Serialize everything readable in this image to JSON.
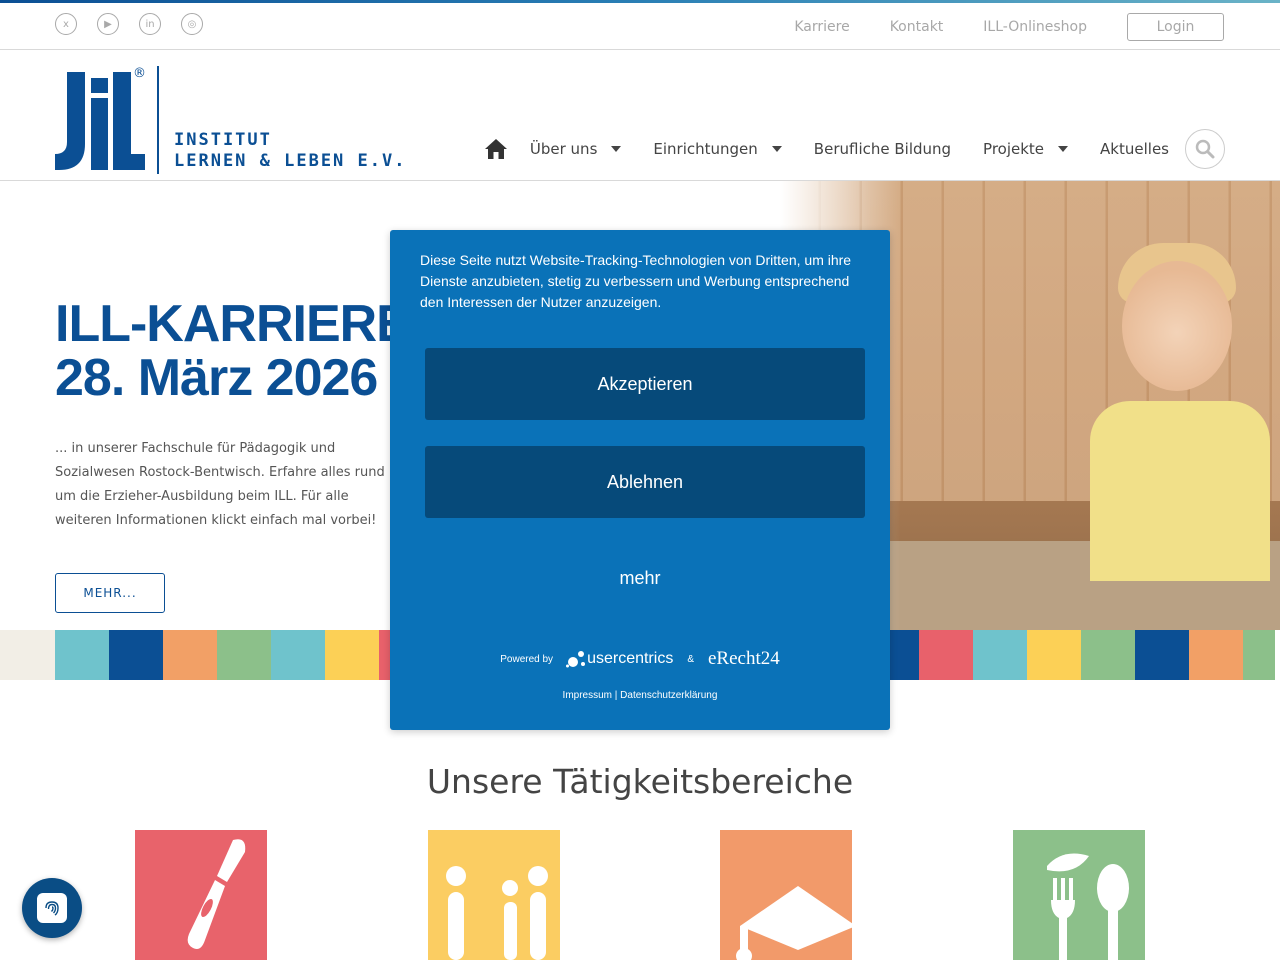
{
  "topbar": {
    "social_icons": [
      "xing-icon",
      "youtube-icon",
      "linkedin-icon",
      "instagram-icon"
    ],
    "links": [
      "Karriere",
      "Kontakt",
      "ILL-Onlineshop"
    ],
    "login_label": "Login"
  },
  "logo": {
    "mark": "JiL",
    "registered": "®",
    "line1": "INSTITUT",
    "line2": "LERNEN & LEBEN E.V."
  },
  "nav": {
    "items": [
      {
        "label": "Über uns",
        "has_dropdown": true
      },
      {
        "label": "Einrichtungen",
        "has_dropdown": true
      },
      {
        "label": "Berufliche Bildung",
        "has_dropdown": false
      },
      {
        "label": "Projekte",
        "has_dropdown": true
      },
      {
        "label": "Aktuelles",
        "has_dropdown": false
      }
    ]
  },
  "hero": {
    "title_line1": "ILL-KARRIERET",
    "title_line2": "28. März 2026",
    "text": "... in unserer Fachschule für Pädagogik und Sozialwesen Rostock-Bentwisch. Erfahre alles rund um die Erzieher-Ausbildung beim ILL. Für alle weiteren Informationen klickt einfach mal vorbei!",
    "button": "MEHR..."
  },
  "cookie_banner": {
    "text": "Diese Seite nutzt Website-Tracking-Technologien von Dritten, um ihre Dienste anzubieten, stetig zu verbessern und Werbung entsprechend den Interessen der Nutzer anzuzeigen.",
    "accept": "Akzeptieren",
    "decline": "Ablehnen",
    "more": "mehr",
    "powered_by": "Powered by",
    "brand1": "usercentrics",
    "amp": "&",
    "brand2": "eRecht24",
    "links": "Impressum | Datenschutzerklärung"
  },
  "section": {
    "title": "Unsere Tätigkeitsbereiche"
  },
  "colors": {
    "brand_blue": "#0b4f94",
    "modal_blue": "#0a72b8",
    "modal_button": "#064a7a",
    "strip": [
      "#6fc3cc",
      "#0b4f94",
      "#f2a066",
      "#8cc08a",
      "#6fc3cc",
      "#fcd056",
      "#e8616b"
    ],
    "tiles": [
      "#e8636b",
      "#fbcd62",
      "#f29a6a",
      "#8cc08a"
    ]
  }
}
